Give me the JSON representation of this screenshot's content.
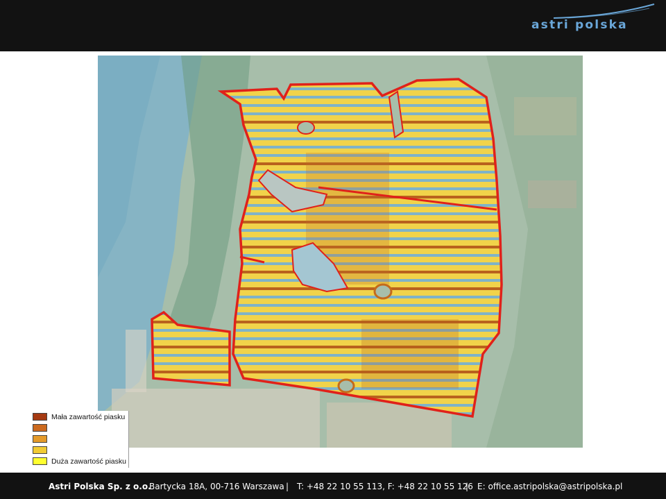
{
  "header": {
    "logo_text": "astri polska"
  },
  "map": {
    "field_colors": {
      "boundary": "#e0211a",
      "stripe_sand": "#f4e53a",
      "stripe_mid": "#e0a830",
      "stripe_low": "#b9621d",
      "stripe_water_blue": "#7fb3c8"
    }
  },
  "legend": {
    "items": [
      {
        "label": "Mała zawartość piasku",
        "color": "#a53a12"
      },
      {
        "label": "",
        "color": "#cc6a1f"
      },
      {
        "label": "",
        "color": "#e49a2a"
      },
      {
        "label": "",
        "color": "#f1cb34"
      },
      {
        "label": "Duża zawartość piasku",
        "color": "#ffff30"
      }
    ]
  },
  "footer": {
    "company": "Astri Polska Sp. z o.o.",
    "address": "Bartycka 18A, 00-716 Warszawa",
    "separator_1": "|",
    "phone": "T: +48 22 10 55 113, F: +48 22 10 55 126",
    "separator_2": "|",
    "email": "E:  office.astripolska@astripolska.pl"
  }
}
